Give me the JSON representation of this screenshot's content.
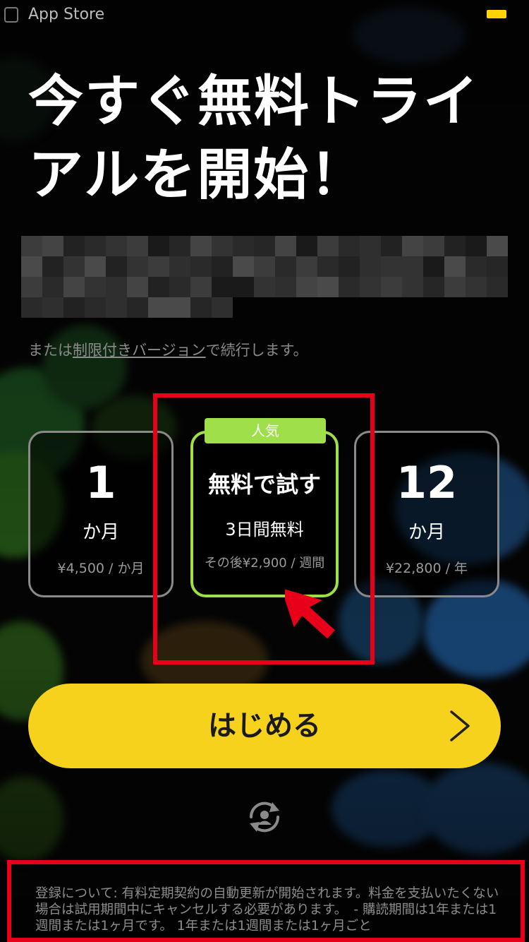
{
  "status_bar": {
    "back_label": "App Store"
  },
  "title": "今すぐ無料トライアルを開始！",
  "limited_prefix": "または",
  "limited_link": "制限付きバージョン",
  "limited_suffix": "で続行します。",
  "plans": [
    {
      "big": "1",
      "unit": "か月",
      "price": "¥4,500 / か月"
    },
    {
      "badge": "人気",
      "big": "無料で試す",
      "unit": "3日間無料",
      "price": "その後¥2,900 / 週間"
    },
    {
      "big": "12",
      "unit": "か月",
      "price": "¥22,800 / 年"
    }
  ],
  "start_button": "はじめる",
  "terms": "登録について: 有料定期契約の自動更新が開始されます。料金を支払いたくない場合は試用期間中にキャンセルする必要があります。　- 購読期間は1年または1週間または1ヶ月です。 1年または1週間または1ヶ月ごと",
  "colors": {
    "accent_yellow": "#f6d21d",
    "popular_green": "#9fe04a",
    "highlight_red": "#e8001a"
  },
  "icons": {
    "start_chevron": "chevron-right-icon",
    "restore": "restore-account-icon"
  }
}
